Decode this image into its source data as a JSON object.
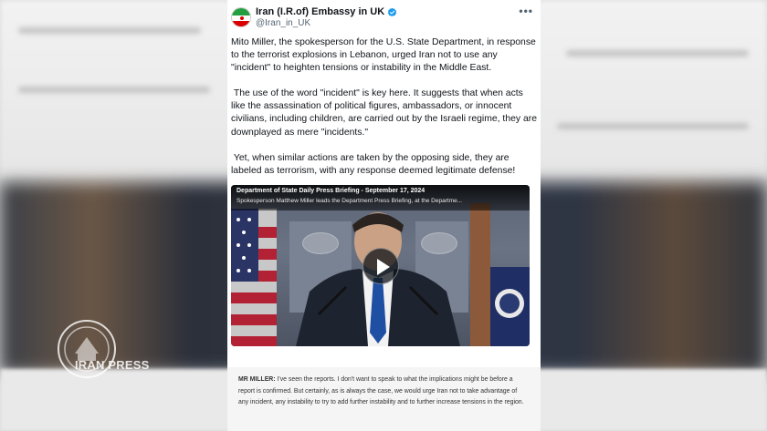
{
  "tweet": {
    "author_name": "Iran (I.R.of) Embassy in UK",
    "handle": "@Iran_in_UK",
    "verified": true,
    "more_label": "•••",
    "paragraphs": [
      "Mito Miller, the spokesperson for the U.S. State Department, in response to the terrorist explosions in Lebanon, urged Iran not to use any \"incident\" to heighten tensions or instability in the Middle East.",
      " The use of the word \"incident\" is key here. It suggests that when acts like the assassination of political figures, ambassadors, or innocent civilians, including children, are carried out by the Israeli regime, they are downplayed as mere \"incidents.\"",
      " Yet, when similar actions are taken by the opposing side, they are labeled as terrorism, with any response deemed legitimate defense!"
    ]
  },
  "video": {
    "title": "Department of State Daily Press Briefing - September 17, 2024",
    "subtitle": "Spokesperson Matthew Miller leads the Department Press Briefing, at the Departme..."
  },
  "transcript": {
    "speaker": "MR MILLER:",
    "text": " I've seen the reports. I don't want to speak to what the implications might be before a report is confirmed. But certainly, as is always the case, we would urge Iran not to take advantage of any incident, any instability to try to add further instability and to further increase tensions in the region."
  },
  "watermark": {
    "text": "IRAN PRESS"
  },
  "colors": {
    "verified_blue": "#1d9bf0",
    "text_primary": "#0f1419",
    "text_secondary": "#536471"
  },
  "icons": {
    "verified": "verified-badge-icon",
    "more": "more-options-icon",
    "play": "play-icon",
    "avatar": "iran-flag-avatar"
  }
}
